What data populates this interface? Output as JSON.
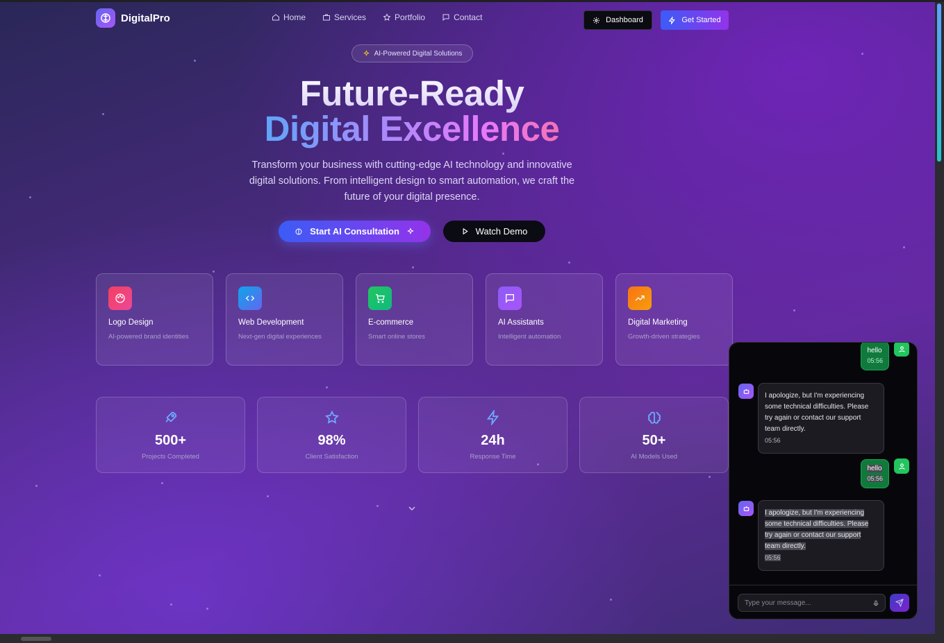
{
  "nav": {
    "brand": "DigitalPro",
    "links": [
      "Home",
      "Services",
      "Portfolio",
      "Contact"
    ],
    "dashboard_label": "Dashboard",
    "get_started_label": "Get Started"
  },
  "hero": {
    "badge": "AI-Powered Digital Solutions",
    "title_line1": "Future-Ready",
    "title_line2": "Digital Excellence",
    "lead": "Transform your business with cutting-edge AI technology and innovative digital solutions. From intelligent design to smart automation, we craft the future of your digital presence.",
    "cta_primary": "Start AI Consultation",
    "cta_secondary": "Watch Demo"
  },
  "services": [
    {
      "title": "Logo Design",
      "desc": "AI-powered brand identities",
      "icon": "palette-icon",
      "color": "#ec4899"
    },
    {
      "title": "Web Development",
      "desc": "Next-gen digital experiences",
      "icon": "code-icon",
      "color": "#0ea5e9"
    },
    {
      "title": "E-commerce",
      "desc": "Smart online stores",
      "icon": "cart-icon",
      "color": "#22c55e"
    },
    {
      "title": "AI Assistants",
      "desc": "Intelligent automation",
      "icon": "chat-icon",
      "color": "#a855f7"
    },
    {
      "title": "Digital Marketing",
      "desc": "Growth-driven strategies",
      "icon": "trending-up-icon",
      "color": "#f97316"
    }
  ],
  "stats": [
    {
      "value": "500+",
      "label": "Projects Completed",
      "icon": "rocket-icon"
    },
    {
      "value": "98%",
      "label": "Client Satisfaction",
      "icon": "star-icon"
    },
    {
      "value": "24h",
      "label": "Response Time",
      "icon": "zap-icon"
    },
    {
      "value": "50+",
      "label": "AI Models Used",
      "icon": "brain-icon"
    }
  ],
  "chat": {
    "messages": [
      {
        "role": "user",
        "text": "hello",
        "time": "05:56"
      },
      {
        "role": "bot",
        "text": "I apologize, but I'm experiencing some technical difficulties. Please try again or contact our support team directly.",
        "time": "05:56"
      },
      {
        "role": "user",
        "text": "hello",
        "time": "05:56"
      },
      {
        "role": "bot",
        "text": "I apologize, but I'm experiencing some technical difficulties. Please try again or contact our support team directly.",
        "time": "05:56"
      }
    ],
    "input_placeholder": "Type your message..."
  }
}
